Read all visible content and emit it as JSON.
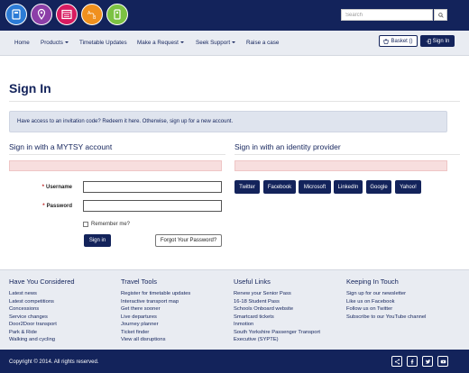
{
  "header": {
    "search_placeholder": "Search",
    "logo_colors": [
      "#2b7bd6",
      "#8c3fa8",
      "#d81b60",
      "#f0901e",
      "#7cc242"
    ]
  },
  "nav": {
    "items": [
      {
        "label": "Home",
        "dropdown": false
      },
      {
        "label": "Products",
        "dropdown": true
      },
      {
        "label": "Timetable Updates",
        "dropdown": false
      },
      {
        "label": "Make a Request",
        "dropdown": true
      },
      {
        "label": "Seek Support",
        "dropdown": true
      },
      {
        "label": "Raise a case",
        "dropdown": false
      }
    ],
    "basket_label": "Basket ()",
    "signin_label": "Sign In"
  },
  "main": {
    "title": "Sign In",
    "info": "Have access to an invitation code? Redeem it here. Otherwise, sign up for a new account."
  },
  "local_account": {
    "title": "Sign in with a MYTSY account",
    "username_label": "Username",
    "password_label": "Password",
    "remember_label": "Remember me?",
    "signin_button": "Sign in",
    "forgot_button": "Forgot Your Password?"
  },
  "identity_provider": {
    "title": "Sign in with an identity provider",
    "providers": [
      "Twitter",
      "Facebook",
      "Microsoft",
      "LinkedIn",
      "Google",
      "Yahoo!"
    ]
  },
  "footer": {
    "columns": [
      {
        "title": "Have You Considered",
        "items": [
          "Latest news",
          "Latest competitions",
          "Concessions",
          "Service changes",
          "Door2Door transport",
          "Park & Ride",
          "Walking and cycling"
        ]
      },
      {
        "title": "Travel Tools",
        "items": [
          "Register for timetable updates",
          "Interactive transport map",
          "Get there sooner",
          "Live departures",
          "Journey planner",
          "Ticket finder",
          "View all disruptions"
        ]
      },
      {
        "title": "Useful Links",
        "items": [
          "Renew your Senior Pass",
          "16-18 Student Pass",
          "Schools Onboard website",
          "Smartcard tickets",
          "Inmotion",
          "South Yorkshire Passenger Transport",
          "Executive (SYPTE)"
        ]
      },
      {
        "title": "Keeping In Touch",
        "items": [
          "Sign up for our newsletter",
          "Like us on Facebook",
          "Follow us on Twitter",
          "Subscribe to our YouTube channel"
        ]
      }
    ],
    "copyright": "Copyright © 2014. All rights reserved.",
    "social_icons": [
      "share-icon",
      "facebook-icon",
      "twitter-icon",
      "youtube-icon"
    ]
  },
  "colors": {
    "brand_navy": "#13235b",
    "nav_bg": "#e9ecf2",
    "error_bg": "#f7dede"
  }
}
